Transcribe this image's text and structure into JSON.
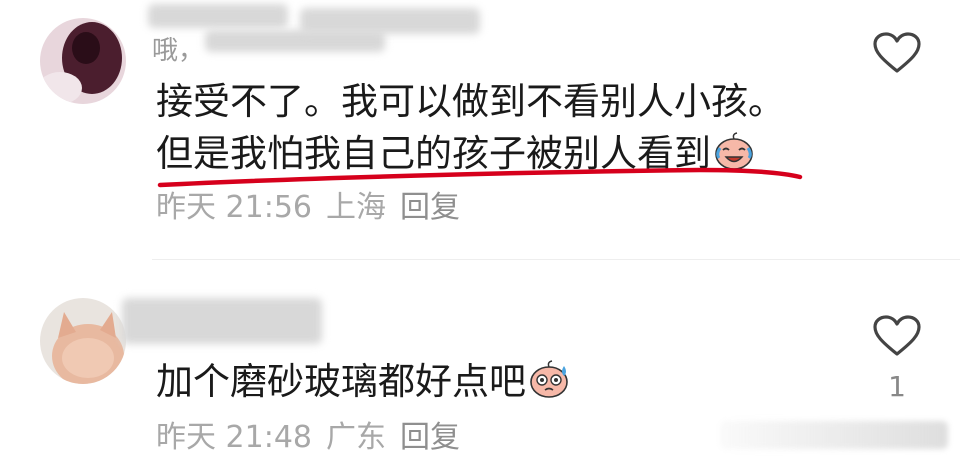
{
  "comments": [
    {
      "username_visible": "哦，",
      "text_line1": "接受不了。我可以做到不看别人小孩。",
      "text_line2": "但是我怕我自己的孩子被别人看到",
      "emoji": "crying-laughing-face",
      "time": "昨天 21:56",
      "location": "上海",
      "reply_label": "回复",
      "like_count": ""
    },
    {
      "username_visible": "",
      "text_line1": "加个磨砂玻璃都好点吧",
      "emoji": "sweating-face",
      "time": "昨天 21:48",
      "location": "广东",
      "reply_label": "回复",
      "like_count": "1"
    }
  ],
  "colors": {
    "underline": "#d6001c",
    "meta": "#a8a8a8",
    "text": "#1a1a1a"
  }
}
